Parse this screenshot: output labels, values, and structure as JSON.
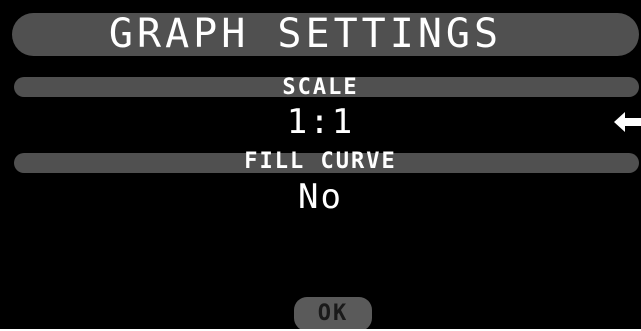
{
  "header": {
    "title": "GRAPH SETTINGS"
  },
  "settings": [
    {
      "label": "SCALE",
      "value": "1:1",
      "selected": true
    },
    {
      "label": "FILL CURVE",
      "value": "No",
      "selected": false
    }
  ],
  "footer": {
    "ok_label": "OK"
  },
  "icons": {
    "selection": "arrow-left-icon"
  },
  "colors": {
    "background": "#000000",
    "bar": "#505050",
    "text": "#ffffff",
    "button": "#5a5a5a",
    "button_text": "#1a1a1a"
  }
}
